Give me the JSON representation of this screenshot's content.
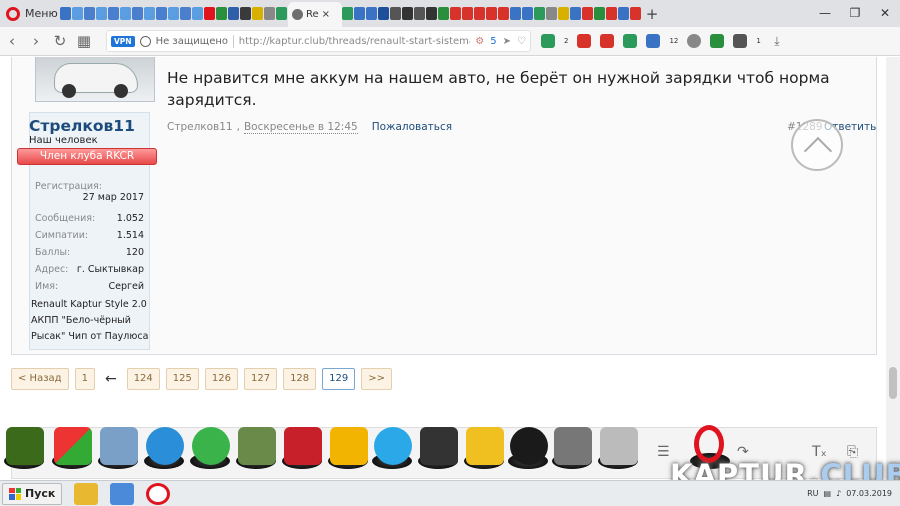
{
  "browser": {
    "menu_label": "Меню",
    "active_tab_label": "Re",
    "tab_close": "×",
    "new_tab": "+",
    "window_controls": [
      "—",
      "❐",
      "✕"
    ],
    "address": {
      "vpn_badge": "VPN",
      "security_text": "Не защищено",
      "url": "http://kaptur.club/threads/renault-start-sistema-distancionno",
      "badge_count": "5"
    },
    "extension_badges": [
      "2",
      "12",
      "1"
    ]
  },
  "post": {
    "message": "Не нравится мне аккум на нашем авто, не берёт он нужной зарядки чтоб норма зарядится.",
    "author": "Стрелков11",
    "date": "Воскресенье в 12:45",
    "report_label": "Пожаловаться",
    "post_number": "#1289",
    "reply_label": "Ответить"
  },
  "user": {
    "name": "Стрелков11",
    "title": "Наш человек",
    "badge": "Член клуба RKCR",
    "fields": [
      {
        "label": "Регистрация:",
        "value": "27 мар 2017"
      },
      {
        "label": "Сообщения:",
        "value": "1.052"
      },
      {
        "label": "Симпатии:",
        "value": "1.514"
      },
      {
        "label": "Баллы:",
        "value": "120"
      },
      {
        "label": "Адрес:",
        "value": "г. Сыктывкар"
      },
      {
        "label": "Имя:",
        "value": "Сергей"
      }
    ],
    "signature": "Renault Kaptur Style 2.0 АКПП \"Бело-чёрный Рысак\" Чип от Паулюса"
  },
  "pagination": {
    "prev": "< Назад",
    "first": "1",
    "gap": "←",
    "pages": [
      "124",
      "125",
      "126",
      "127",
      "128",
      "129"
    ],
    "current": "129",
    "next": ">>"
  },
  "watermark": {
    "kaptur": "KAPTUR.",
    "club": "CLUB"
  },
  "taskbar": {
    "start_label": "Пуск",
    "lang": "RU",
    "date": "07.03.2019"
  },
  "colors": {
    "link": "#1d4c7c",
    "badge_red": "#e84a4a",
    "opera_red": "#e0141e",
    "vpn_blue": "#1e74d8"
  }
}
